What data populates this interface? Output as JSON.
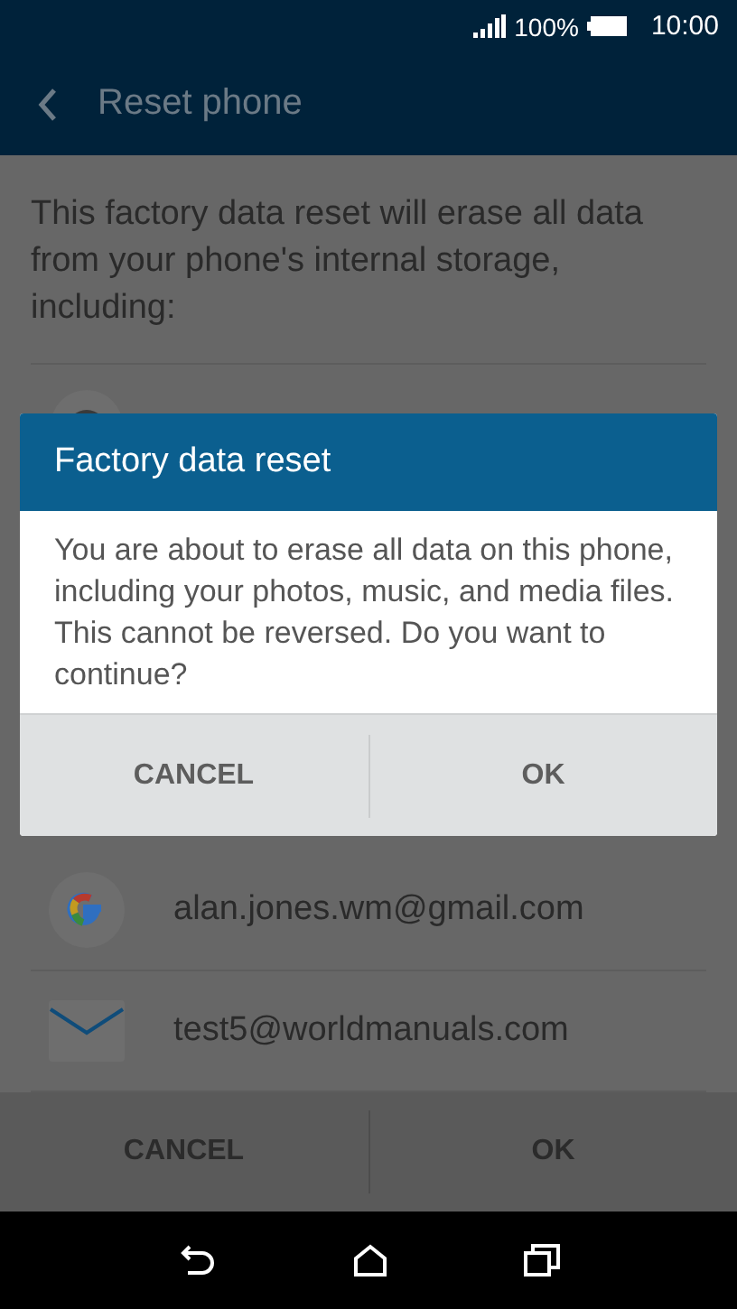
{
  "status_bar": {
    "battery": "100%",
    "time": "10:00"
  },
  "app_bar": {
    "title": "Reset phone"
  },
  "intro": "This factory data reset will erase all data from your phone's internal storage, including:",
  "accounts": [
    {
      "kind": "google",
      "email": "alan.jones.wm@gmail.com"
    },
    {
      "kind": "mail",
      "email": "test5@worldmanuals.com"
    }
  ],
  "footer_buttons": [
    "CANCEL",
    "OK"
  ],
  "dialog": {
    "title": "Factory data reset",
    "message": "You are about to erase all data on this phone, including your photos, music, and media files. This cannot be reversed. Do you want to continue?",
    "buttons": [
      "CANCEL",
      "OK"
    ]
  }
}
